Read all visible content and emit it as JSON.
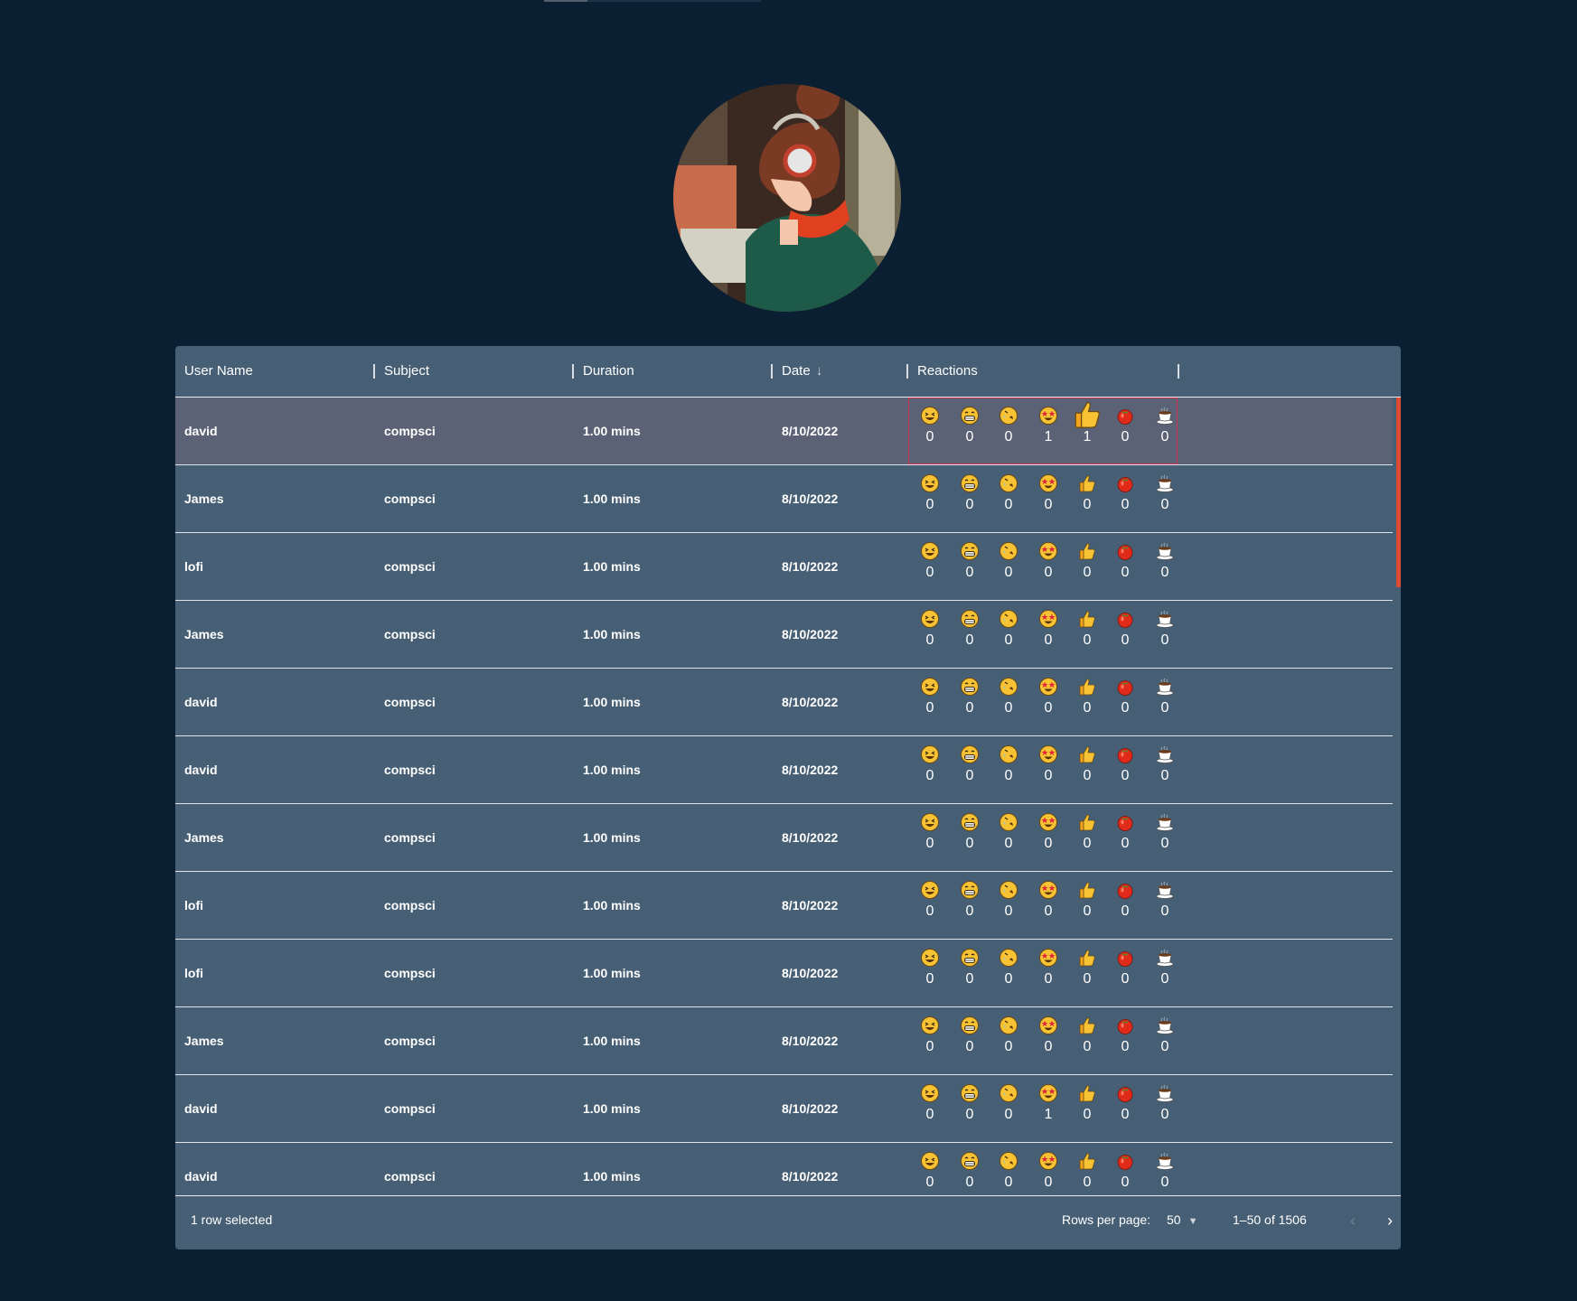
{
  "grid": {
    "columns": [
      "User Name",
      "Subject",
      "Duration",
      "Date",
      "Reactions"
    ],
    "reaction_icons": [
      "grinning-squint-face",
      "beaming-face",
      "rolling-on-floor-laughing",
      "star-struck",
      "thumbs-up",
      "tomato",
      "coffee"
    ],
    "rows": [
      {
        "user": "david",
        "subject": "compsci",
        "duration": "1.00 mins",
        "date": "8/10/2022",
        "counts": [
          "0",
          "0",
          "0",
          "1",
          "1",
          "0",
          "0"
        ],
        "selected": true
      },
      {
        "user": "James",
        "subject": "compsci",
        "duration": "1.00 mins",
        "date": "8/10/2022",
        "counts": [
          "0",
          "0",
          "0",
          "0",
          "0",
          "0",
          "0"
        ]
      },
      {
        "user": "lofi",
        "subject": "compsci",
        "duration": "1.00 mins",
        "date": "8/10/2022",
        "counts": [
          "0",
          "0",
          "0",
          "0",
          "0",
          "0",
          "0"
        ]
      },
      {
        "user": "James",
        "subject": "compsci",
        "duration": "1.00 mins",
        "date": "8/10/2022",
        "counts": [
          "0",
          "0",
          "0",
          "0",
          "0",
          "0",
          "0"
        ]
      },
      {
        "user": "david",
        "subject": "compsci",
        "duration": "1.00 mins",
        "date": "8/10/2022",
        "counts": [
          "0",
          "0",
          "0",
          "0",
          "0",
          "0",
          "0"
        ]
      },
      {
        "user": "david",
        "subject": "compsci",
        "duration": "1.00 mins",
        "date": "8/10/2022",
        "counts": [
          "0",
          "0",
          "0",
          "0",
          "0",
          "0",
          "0"
        ]
      },
      {
        "user": "James",
        "subject": "compsci",
        "duration": "1.00 mins",
        "date": "8/10/2022",
        "counts": [
          "0",
          "0",
          "0",
          "0",
          "0",
          "0",
          "0"
        ]
      },
      {
        "user": "lofi",
        "subject": "compsci",
        "duration": "1.00 mins",
        "date": "8/10/2022",
        "counts": [
          "0",
          "0",
          "0",
          "0",
          "0",
          "0",
          "0"
        ]
      },
      {
        "user": "lofi",
        "subject": "compsci",
        "duration": "1.00 mins",
        "date": "8/10/2022",
        "counts": [
          "0",
          "0",
          "0",
          "0",
          "0",
          "0",
          "0"
        ]
      },
      {
        "user": "James",
        "subject": "compsci",
        "duration": "1.00 mins",
        "date": "8/10/2022",
        "counts": [
          "0",
          "0",
          "0",
          "0",
          "0",
          "0",
          "0"
        ]
      },
      {
        "user": "david",
        "subject": "compsci",
        "duration": "1.00 mins",
        "date": "8/10/2022",
        "counts": [
          "0",
          "0",
          "0",
          "1",
          "0",
          "0",
          "0"
        ]
      },
      {
        "user": "david",
        "subject": "compsci",
        "duration": "1.00 mins",
        "date": "8/10/2022",
        "counts": [
          "0",
          "0",
          "0",
          "0",
          "0",
          "0",
          "0"
        ]
      }
    ]
  },
  "footer": {
    "selected_text": "1 row selected",
    "rows_per_page_label": "Rows per page:",
    "rows_per_page_value": "50",
    "range_text": "1–50 of 1506"
  },
  "colors": {
    "background": "#0b1f32",
    "grid": "#475f75",
    "selected_row": "#5b6276",
    "scroll_thumb": "#dc4b34"
  }
}
